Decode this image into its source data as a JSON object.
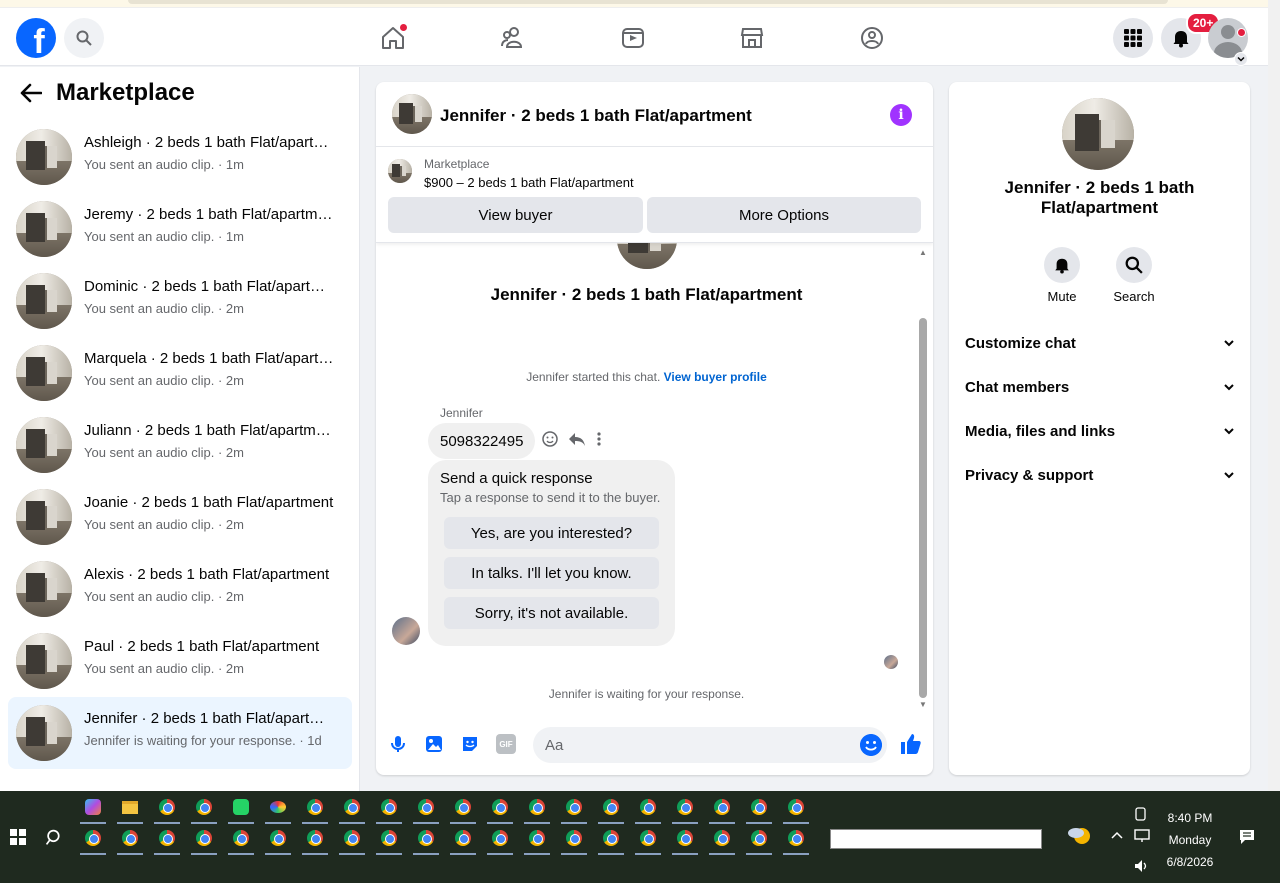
{
  "colors": {
    "brand": "#0866ff",
    "notification": "#e41e3f",
    "info_accent": "#a033ff",
    "link": "#0064d1",
    "active_row": "#ebf5ff"
  },
  "topnav": {
    "logo_letter": "f",
    "notifications_badge": "20+",
    "icons": [
      "home-icon",
      "friends-icon",
      "video-icon",
      "marketplace-icon",
      "groups-icon",
      "menu-grid-icon",
      "bell-icon",
      "profile-avatar"
    ]
  },
  "sidebar": {
    "title": "Marketplace",
    "conversations": [
      {
        "name": "Ashleigh · 2 beds 1 bath Flat/apartment",
        "snippet": "You sent an audio clip. · 1m"
      },
      {
        "name": "Jeremy · 2 beds 1 bath Flat/apartment",
        "snippet": "You sent an audio clip. · 1m"
      },
      {
        "name": "Dominic · 2 beds 1 bath Flat/apartment",
        "snippet": "You sent an audio clip. · 2m"
      },
      {
        "name": "Marquela · 2 beds 1 bath Flat/apartment",
        "snippet": "You sent an audio clip. · 2m"
      },
      {
        "name": "Juliann · 2 beds 1 bath Flat/apartment",
        "snippet": "You sent an audio clip. · 2m"
      },
      {
        "name": "Joanie · 2 beds 1 bath Flat/apartment",
        "snippet": "You sent an audio clip. · 2m"
      },
      {
        "name": "Alexis · 2 beds 1 bath Flat/apartment",
        "snippet": "You sent an audio clip. · 2m"
      },
      {
        "name": "Paul · 2 beds 1 bath Flat/apartment",
        "snippet": "You sent an audio clip. · 2m"
      },
      {
        "name": "Jennifer · 2 beds 1 bath Flat/apartment",
        "snippet": "Jennifer is waiting for your response. · 1d"
      }
    ]
  },
  "chat": {
    "title": "Jennifer · 2 beds 1 bath Flat/apartment",
    "listing_label": "Marketplace",
    "listing_price": "$900 – 2 beds 1 bath Flat/apartment",
    "view_buyer": "View buyer",
    "more_options": "More Options",
    "body_title": "Jennifer · 2 beds 1 bath Flat/apartment",
    "started_text": "Jennifer started this chat.",
    "started_link": "View buyer profile",
    "sender": "Jennifer",
    "phone_message": "5098322495",
    "quick_title": "Send a quick response",
    "quick_sub": "Tap a response to send it to the buyer.",
    "quick_replies": [
      "Yes, are you interested?",
      "In talks. I'll let you know.",
      "Sorry, it's not available."
    ],
    "waiting": "Jennifer is waiting for your response.",
    "input_placeholder": "Aa",
    "gif_label": "GIF"
  },
  "info": {
    "title": "Jennifer · 2 beds 1 bath Flat/apartment",
    "mute": "Mute",
    "search": "Search",
    "sections": [
      "Customize chat",
      "Chat members",
      "Media, files and links",
      "Privacy & support"
    ]
  },
  "taskbar": {
    "time": "8:40 PM",
    "day": "Monday",
    "date": "6/8/2026"
  }
}
